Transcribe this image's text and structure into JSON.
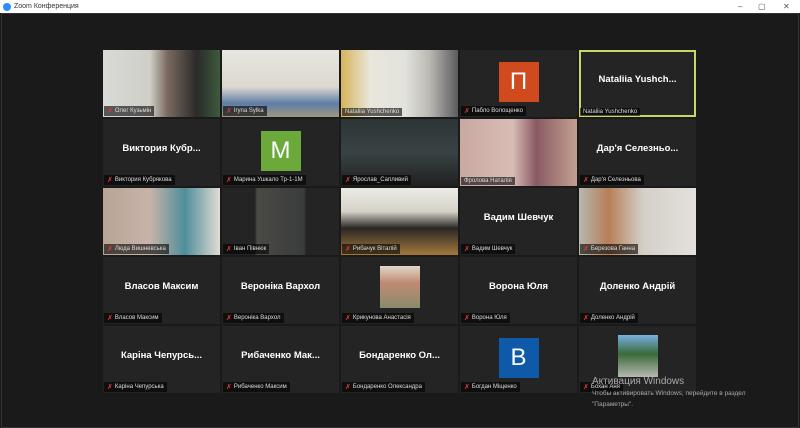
{
  "window": {
    "title": "Zoom Конференция",
    "controls": [
      "–",
      "▢",
      "✕"
    ]
  },
  "tiles": [
    {
      "type": "video",
      "label": "Олег Кузьмін",
      "muted": true,
      "bg": "linear-gradient(90deg,#d9dad6 0%,#cfcfc8 40%,#7a6a60 55%,#2a2a2a 80%,#3e5a3c 100%)"
    },
    {
      "type": "video",
      "label": "Iryna Sylka",
      "muted": true,
      "bg": "linear-gradient(180deg,#e8e6e0 0%,#dcd8cf 55%,#5f7da6 80%,#a09880 100%)"
    },
    {
      "type": "video",
      "label": "Nataliia Yushchenko",
      "muted": false,
      "bg": "linear-gradient(90deg,#d6b45a 0%,#e9e6dc 25%,#e2e2dc 55%,#bdbab4 75%,#5c5c60 100%)"
    },
    {
      "type": "avatar",
      "label": "Пабло Волощенко",
      "muted": true,
      "letter": "П",
      "color": "#d04a1d"
    },
    {
      "type": "name",
      "label": "Nataliia Yushchenko",
      "muted": false,
      "name": "Nataliia  Yushch...",
      "active": true
    },
    {
      "type": "name",
      "label": "Виктория Кубрякова",
      "muted": true,
      "name": "Виктория  Кубр..."
    },
    {
      "type": "avatar",
      "label": "Марина Ушкало Тр-1-1М",
      "muted": true,
      "letter": "M",
      "color": "#6aa93a"
    },
    {
      "type": "video",
      "label": "Ярослав_Сапливий",
      "muted": true,
      "bg": "linear-gradient(180deg,#2c3436 0%,#394244 50%,#202020 100%)"
    },
    {
      "type": "video",
      "label": "Фролова Наталія",
      "muted": false,
      "bg": "linear-gradient(90deg,#c9a9a2 0%,#d8bdb5 45%,#8a5a64 65%,#c2a090 100%)"
    },
    {
      "type": "name",
      "label": "Дар'я Селезньова",
      "muted": true,
      "name": "Дар'я  Селезньо..."
    },
    {
      "type": "video",
      "label": "Люда Вишневська",
      "muted": true,
      "bg": "linear-gradient(90deg,#b7a496 0%,#c8b3a8 40%,#4f8e9b 70%,#e2dcd4 100%)"
    },
    {
      "type": "video",
      "label": "Іван Півнюк",
      "muted": true,
      "bg": "linear-gradient(90deg,#242424 28%,#4a4a44 30%,#3a3c3c 70%,#242424 72%)"
    },
    {
      "type": "video",
      "label": "Рибачук Віталій",
      "muted": true,
      "bg": "linear-gradient(180deg,#ebebe6 0%,#d6d2c8 35%,#2a2624 60%,#a27a3c 100%)"
    },
    {
      "type": "name",
      "label": "Вадим Шевчук",
      "muted": true,
      "name": "Вадим Шевчук"
    },
    {
      "type": "video",
      "label": "Березова Ганна",
      "muted": true,
      "bg": "linear-gradient(90deg,#b8b8b0 0%,#b57e58 25%,#d4d0c8 55%,#e4e0dc 100%)"
    },
    {
      "type": "name",
      "label": "Власов Максим",
      "muted": true,
      "name": "Власов Максим"
    },
    {
      "type": "name",
      "label": "Вероніка Вархол",
      "muted": true,
      "name": "Вероніка Вархол"
    },
    {
      "type": "photo",
      "label": "Крикунова Анастасія",
      "muted": true,
      "bg": "linear-gradient(180deg,#e0d8c8 0%,#c08a74 40%,#8a8a6c 100%)"
    },
    {
      "type": "name",
      "label": "Ворона Юля",
      "muted": true,
      "name": "Ворона Юля"
    },
    {
      "type": "name",
      "label": "Доленко Андрій",
      "muted": true,
      "name": "Доленко Андрій"
    },
    {
      "type": "name",
      "label": "Каріна Чепурська",
      "muted": true,
      "name": "Каріна  Чепурсь..."
    },
    {
      "type": "name",
      "label": "Рибаченко Максим",
      "muted": true,
      "name": "Рибаченко  Мак..."
    },
    {
      "type": "name",
      "label": "Бондаренко Олександра",
      "muted": true,
      "name": "Бондаренко  Ол..."
    },
    {
      "type": "avatar",
      "label": "Богдан Міщенко",
      "muted": true,
      "letter": "B",
      "color": "#0e5aa8"
    },
    {
      "type": "photo",
      "label": "Бохан Аня",
      "muted": true,
      "bg": "linear-gradient(180deg,#7ab0e0 0%,#3a6a3a 45%,#b8b8b0 100%)"
    }
  ],
  "watermark": {
    "title": "Активация Windows",
    "line1": "Чтобы активировать Windows, перейдите в раздел",
    "line2": "\"Параметры\"."
  }
}
